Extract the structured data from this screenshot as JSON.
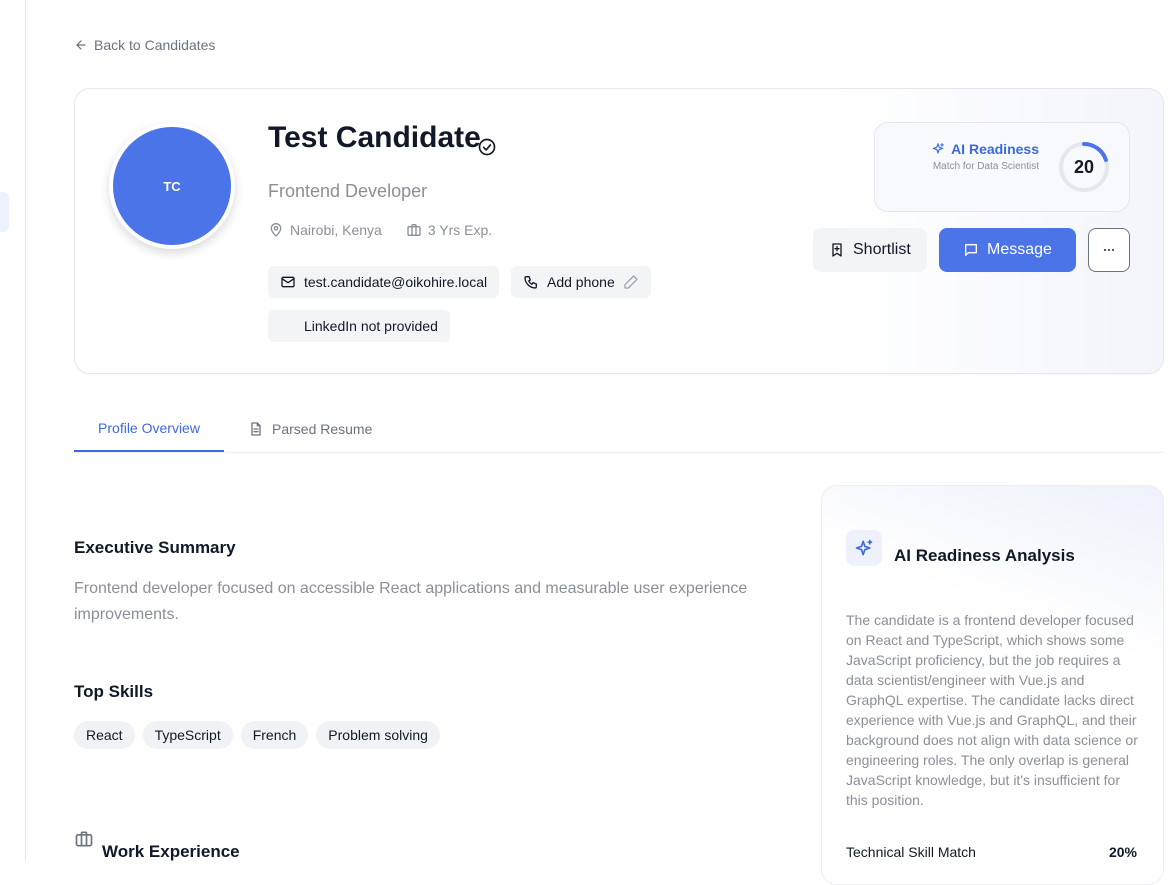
{
  "nav": {
    "back_label": "Back to Candidates"
  },
  "candidate": {
    "initials": "TC",
    "name": "Test Candidate",
    "role": "Frontend Developer",
    "location": "Nairobi, Kenya",
    "experience": "3 Yrs Exp.",
    "email": "test.candidate@oikohire.local",
    "phone_label": "Add phone",
    "linkedin_label": "LinkedIn not provided"
  },
  "readiness": {
    "title": "AI Readiness",
    "subtitle": "Match for Data Scientist",
    "score": "20",
    "score_fraction": 0.2
  },
  "actions": {
    "shortlist_label": "Shortlist",
    "message_label": "Message"
  },
  "tabs": [
    {
      "label": "Profile Overview",
      "active": true
    },
    {
      "label": "Parsed Resume",
      "active": false
    }
  ],
  "summary": {
    "title": "Executive Summary",
    "text": "Frontend developer focused on accessible React applications and measurable user experience improvements."
  },
  "skills": {
    "title": "Top Skills",
    "items": [
      "React",
      "TypeScript",
      "French",
      "Problem solving"
    ]
  },
  "work": {
    "title": "Work Experience"
  },
  "analysis": {
    "title": "AI Readiness Analysis",
    "text": "The candidate is a frontend developer focused on React and TypeScript, which shows some JavaScript proficiency, but the job requires a data scientist/engineer with Vue.js and GraphQL expertise. The candidate lacks direct experience with Vue.js and GraphQL, and their background does not align with data science or engineering roles. The only overlap is general JavaScript knowledge, but it's insufficient for this position.",
    "metric_label": "Technical Skill Match",
    "metric_value": "20%"
  },
  "colors": {
    "accent": "#4a74e8",
    "accent_text": "#3b6ae0",
    "muted": "#8a8f98"
  }
}
